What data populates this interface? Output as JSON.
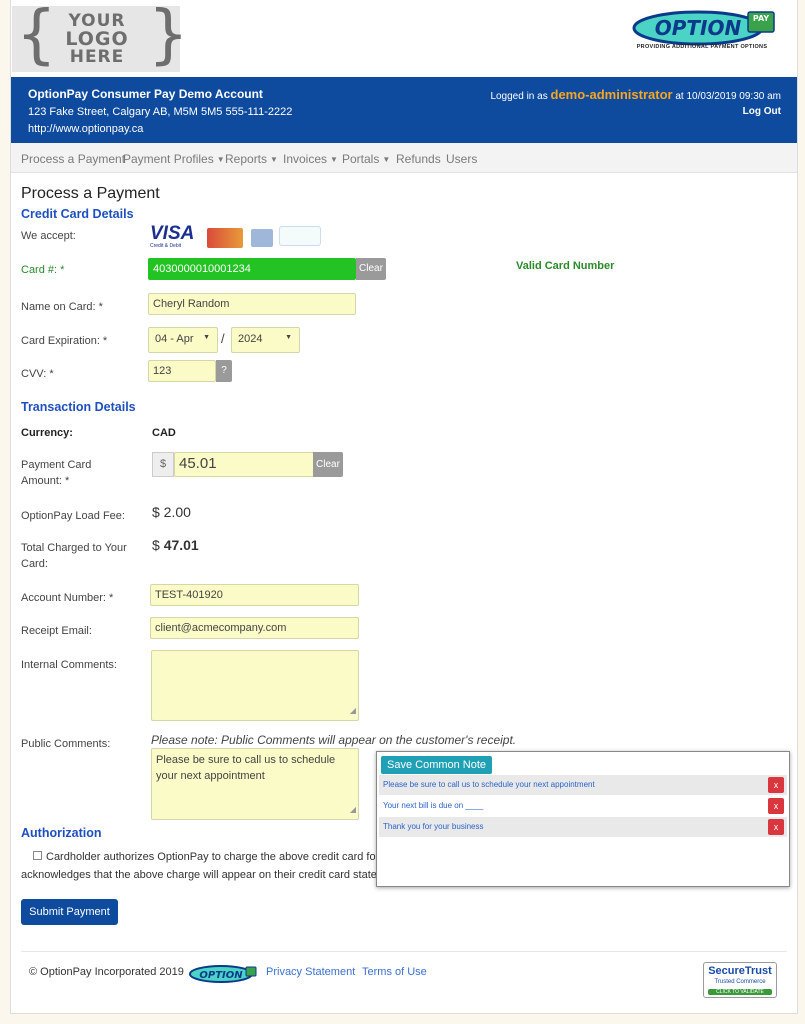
{
  "header": {
    "logo_placeholder": [
      "YOUR",
      "LOGO",
      "HERE"
    ],
    "brand_logo_text": "OPTION",
    "brand_logo_pay": "PAY",
    "brand_tagline": "PROVIDING ADDITIONAL PAYMENT OPTIONS"
  },
  "banner": {
    "account_name": "OptionPay Consumer Pay Demo Account",
    "address": "123 Fake Street, Calgary AB, M5M 5M5   555-111-2222",
    "website": "http://www.optionpay.ca",
    "logged_in_prefix": "Logged in as ",
    "username": "demo-administrator",
    "logged_in_suffix": " at 10/03/2019 09:30 am",
    "logout": "Log Out"
  },
  "nav": [
    {
      "label": "Process a Payment",
      "dropdown": false
    },
    {
      "label": "Payment Profiles",
      "dropdown": true
    },
    {
      "label": "Reports",
      "dropdown": true
    },
    {
      "label": "Invoices",
      "dropdown": true
    },
    {
      "label": "Portals",
      "dropdown": true
    },
    {
      "label": "Refunds",
      "dropdown": false
    },
    {
      "label": "Users",
      "dropdown": false
    }
  ],
  "page_title": "Process a Payment",
  "credit_card": {
    "section_title": "Credit Card Details",
    "we_accept_label": "We accept:",
    "visa_text": "VISA",
    "visa_sub": "Credit & Debit",
    "card_number_label": "Card #: *",
    "card_number_value": "4030000010001234",
    "clear_label": "Clear",
    "validation_text": "Valid Card Number",
    "name_label": "Name on Card: *",
    "name_value": "Cheryl Random",
    "expiry_label": "Card Expiration: *",
    "expiry_month": "04 - Apr",
    "expiry_separator": "/",
    "expiry_year": "2024",
    "cvv_label": "CVV: *",
    "cvv_value": "123",
    "cvv_help": "?"
  },
  "transaction": {
    "section_title": "Transaction Details",
    "currency_label": "Currency:",
    "currency_value": "CAD",
    "amount_label": "Payment Card Amount: *",
    "currency_symbol": "$",
    "amount_value": "45.01",
    "clear_label": "Clear",
    "load_fee_label": "OptionPay Load Fee:",
    "load_fee_value": "$ 2.00",
    "total_label": "Total Charged to Your Card:",
    "total_symbol": "$ ",
    "total_value": "47.01",
    "account_label": "Account Number: *",
    "account_value": "TEST-401920",
    "email_label": "Receipt Email:",
    "email_value": "client@acmecompany.com",
    "internal_label": "Internal Comments:",
    "internal_value": "",
    "public_label": "Public Comments:",
    "public_note": "Please note: Public Comments will appear on the customer's receipt.",
    "public_value": "Please be sure to call us to schedule your next appointment"
  },
  "common_notes": {
    "save_label": "Save Common Note",
    "notes": [
      "Please be sure to call us to schedule your next appointment",
      "Your next bill is due on ____",
      "Thank you for your business"
    ],
    "remove_label": "x"
  },
  "authorization": {
    "section_title": "Authorization",
    "text": "Cardholder authorizes OptionPay to charge the above credit card for the purchase of the OptionPay Payment Card and load fee. Cardholder acknowledges that the above charge will appear on their credit card statement as OPCARD.CA UTILITY SRVS.",
    "submit_label": "Submit Payment"
  },
  "footer": {
    "copyright": "© OptionPay Incorporated 2019",
    "footer_logo_text": "OPTION",
    "privacy": "Privacy Statement",
    "terms": "Terms of Use",
    "secure_title": "SecureTrust",
    "secure_sub": "Trusted Commerce",
    "secure_cta": "CLICK TO VALIDATE"
  },
  "colors": {
    "banner": "#0e4a9e",
    "username": "#f5a623",
    "valid_field": "#22c322",
    "section_heading": "#1f4fbf",
    "field_bg": "#fbfbc7",
    "note_button": "#1fa0b5",
    "remove_button": "#d9363e"
  }
}
